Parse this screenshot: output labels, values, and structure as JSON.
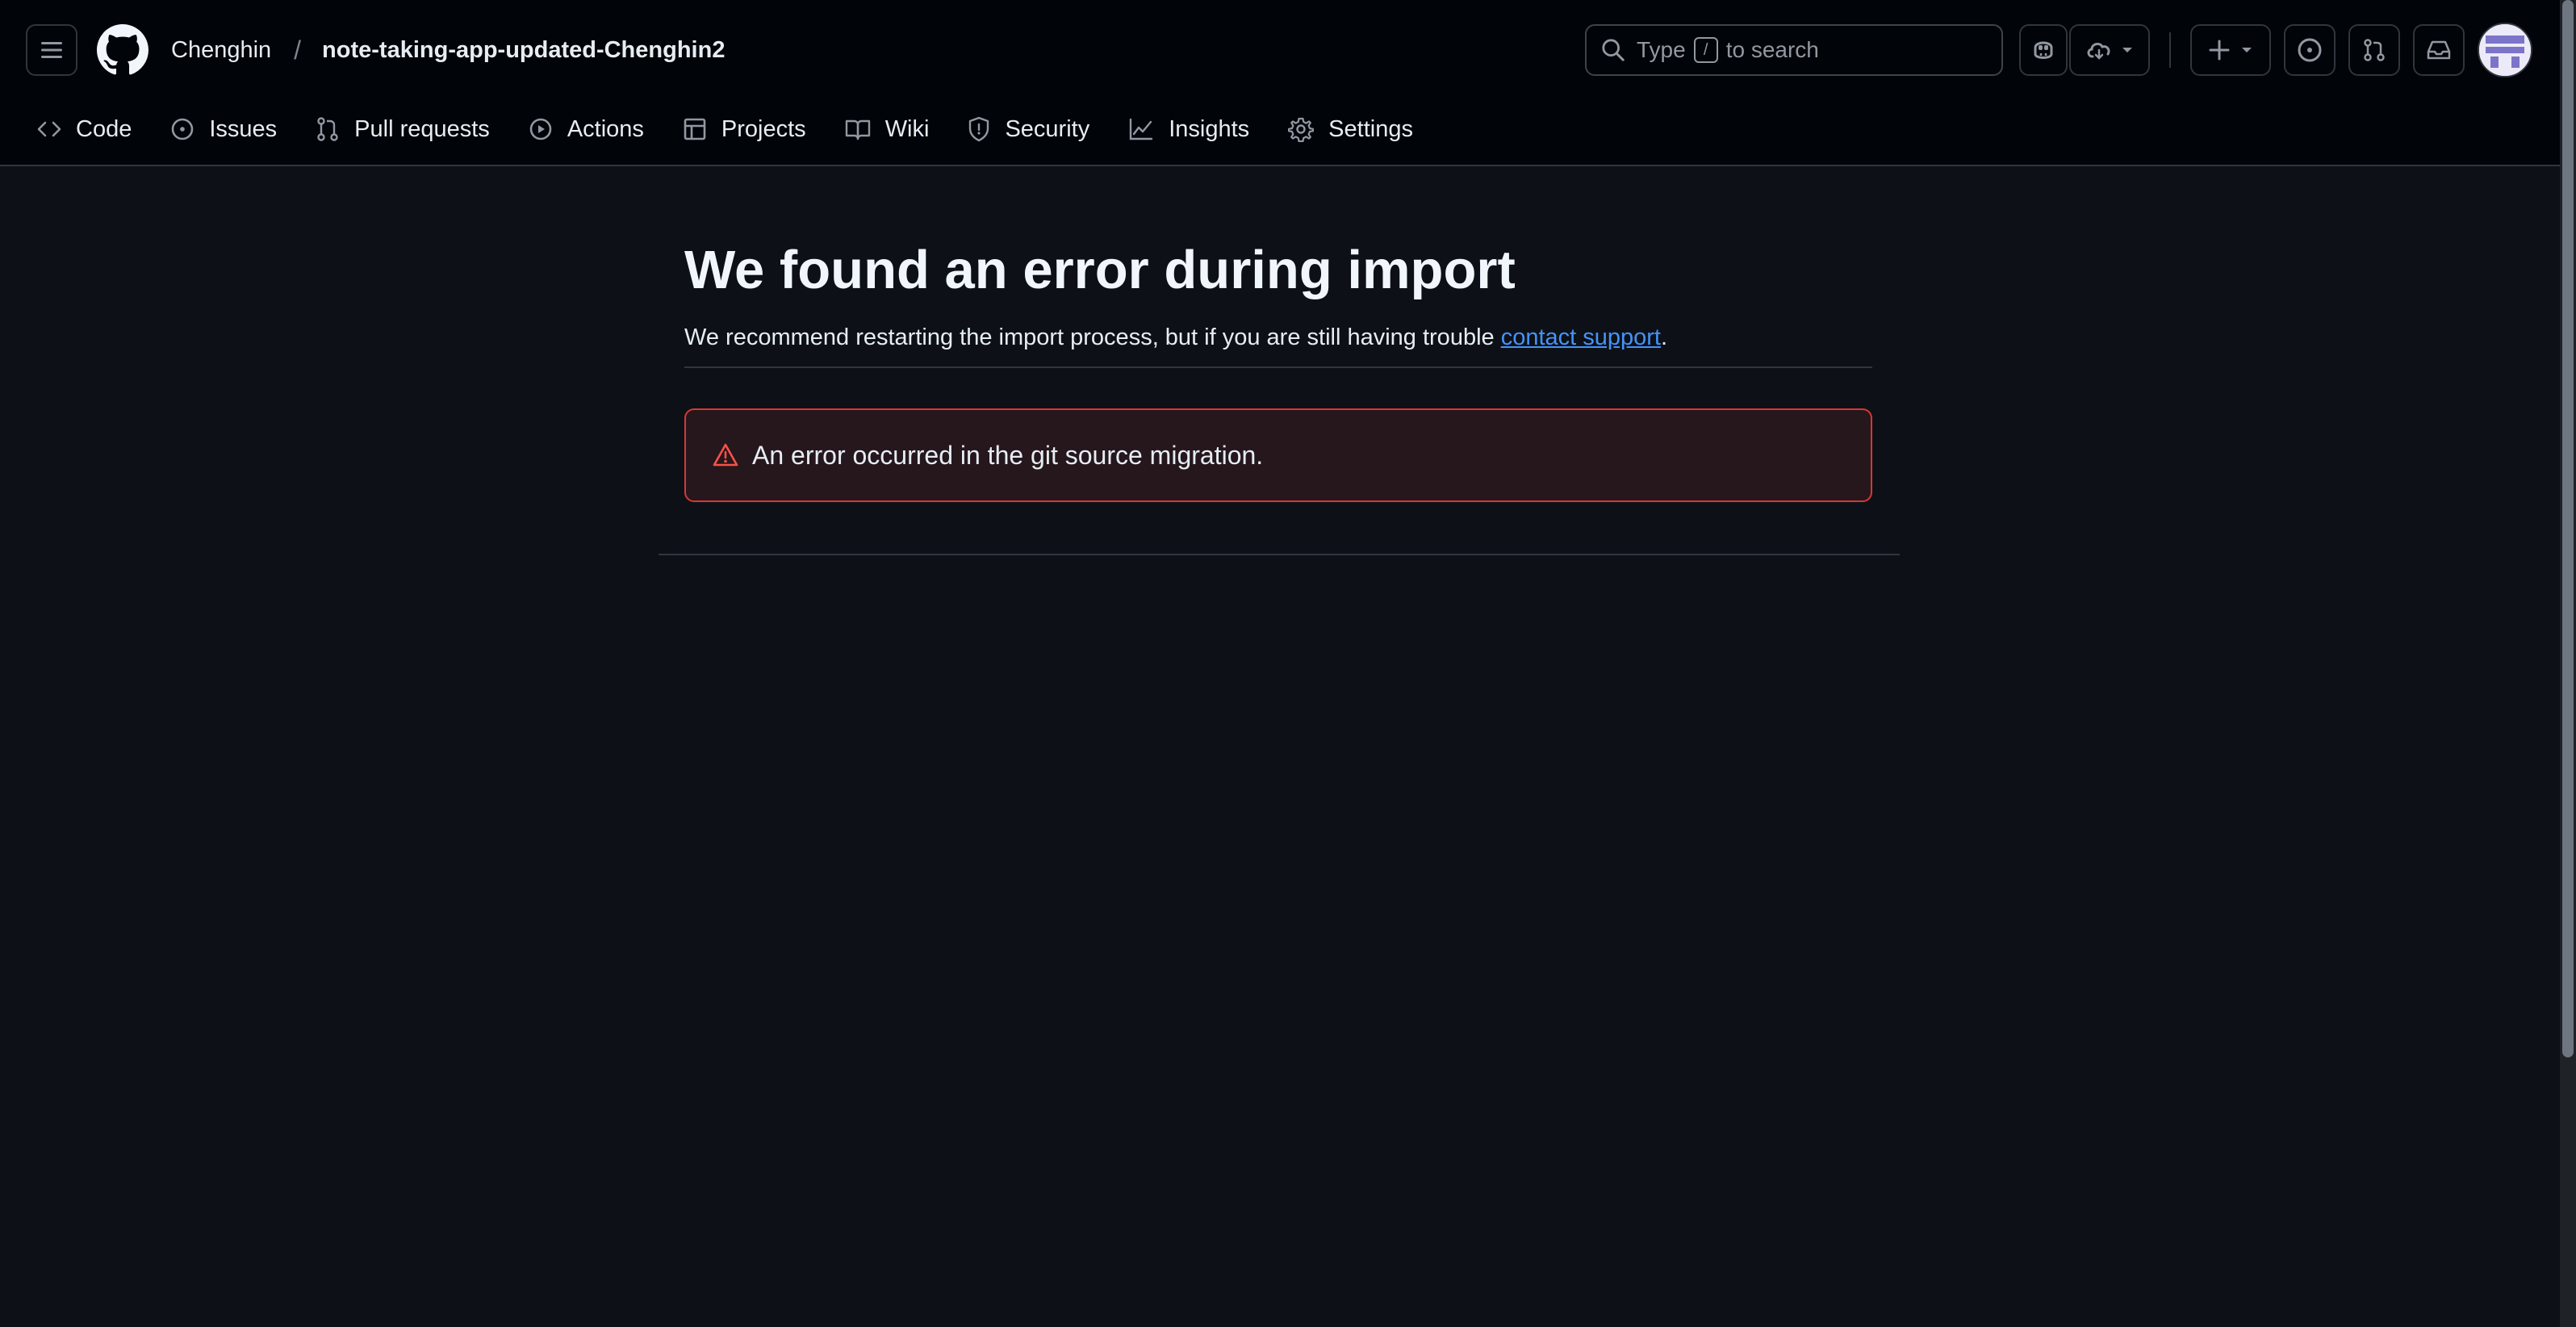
{
  "breadcrumb": {
    "owner": "Chenghin",
    "separator": "/",
    "repo": "note-taking-app-updated-Chenghin2"
  },
  "search": {
    "prefix": "Type",
    "key": "/",
    "suffix": "to search"
  },
  "nav": {
    "tabs": [
      {
        "label": "Code",
        "icon": "code-icon"
      },
      {
        "label": "Issues",
        "icon": "issue-icon"
      },
      {
        "label": "Pull requests",
        "icon": "pull-request-icon"
      },
      {
        "label": "Actions",
        "icon": "play-icon"
      },
      {
        "label": "Projects",
        "icon": "table-icon"
      },
      {
        "label": "Wiki",
        "icon": "book-icon"
      },
      {
        "label": "Security",
        "icon": "shield-icon"
      },
      {
        "label": "Insights",
        "icon": "graph-icon"
      },
      {
        "label": "Settings",
        "icon": "gear-icon"
      }
    ]
  },
  "main": {
    "title": "We found an error during import",
    "subtitle_before": "We recommend restarting the import process, but if you are still having trouble ",
    "subtitle_link": "contact support",
    "subtitle_after": ".",
    "error_message": "An error occurred in the git source migration."
  },
  "colors": {
    "background": "#0d1117",
    "header": "#010409",
    "link": "#4493f8",
    "danger": "#f85149"
  }
}
